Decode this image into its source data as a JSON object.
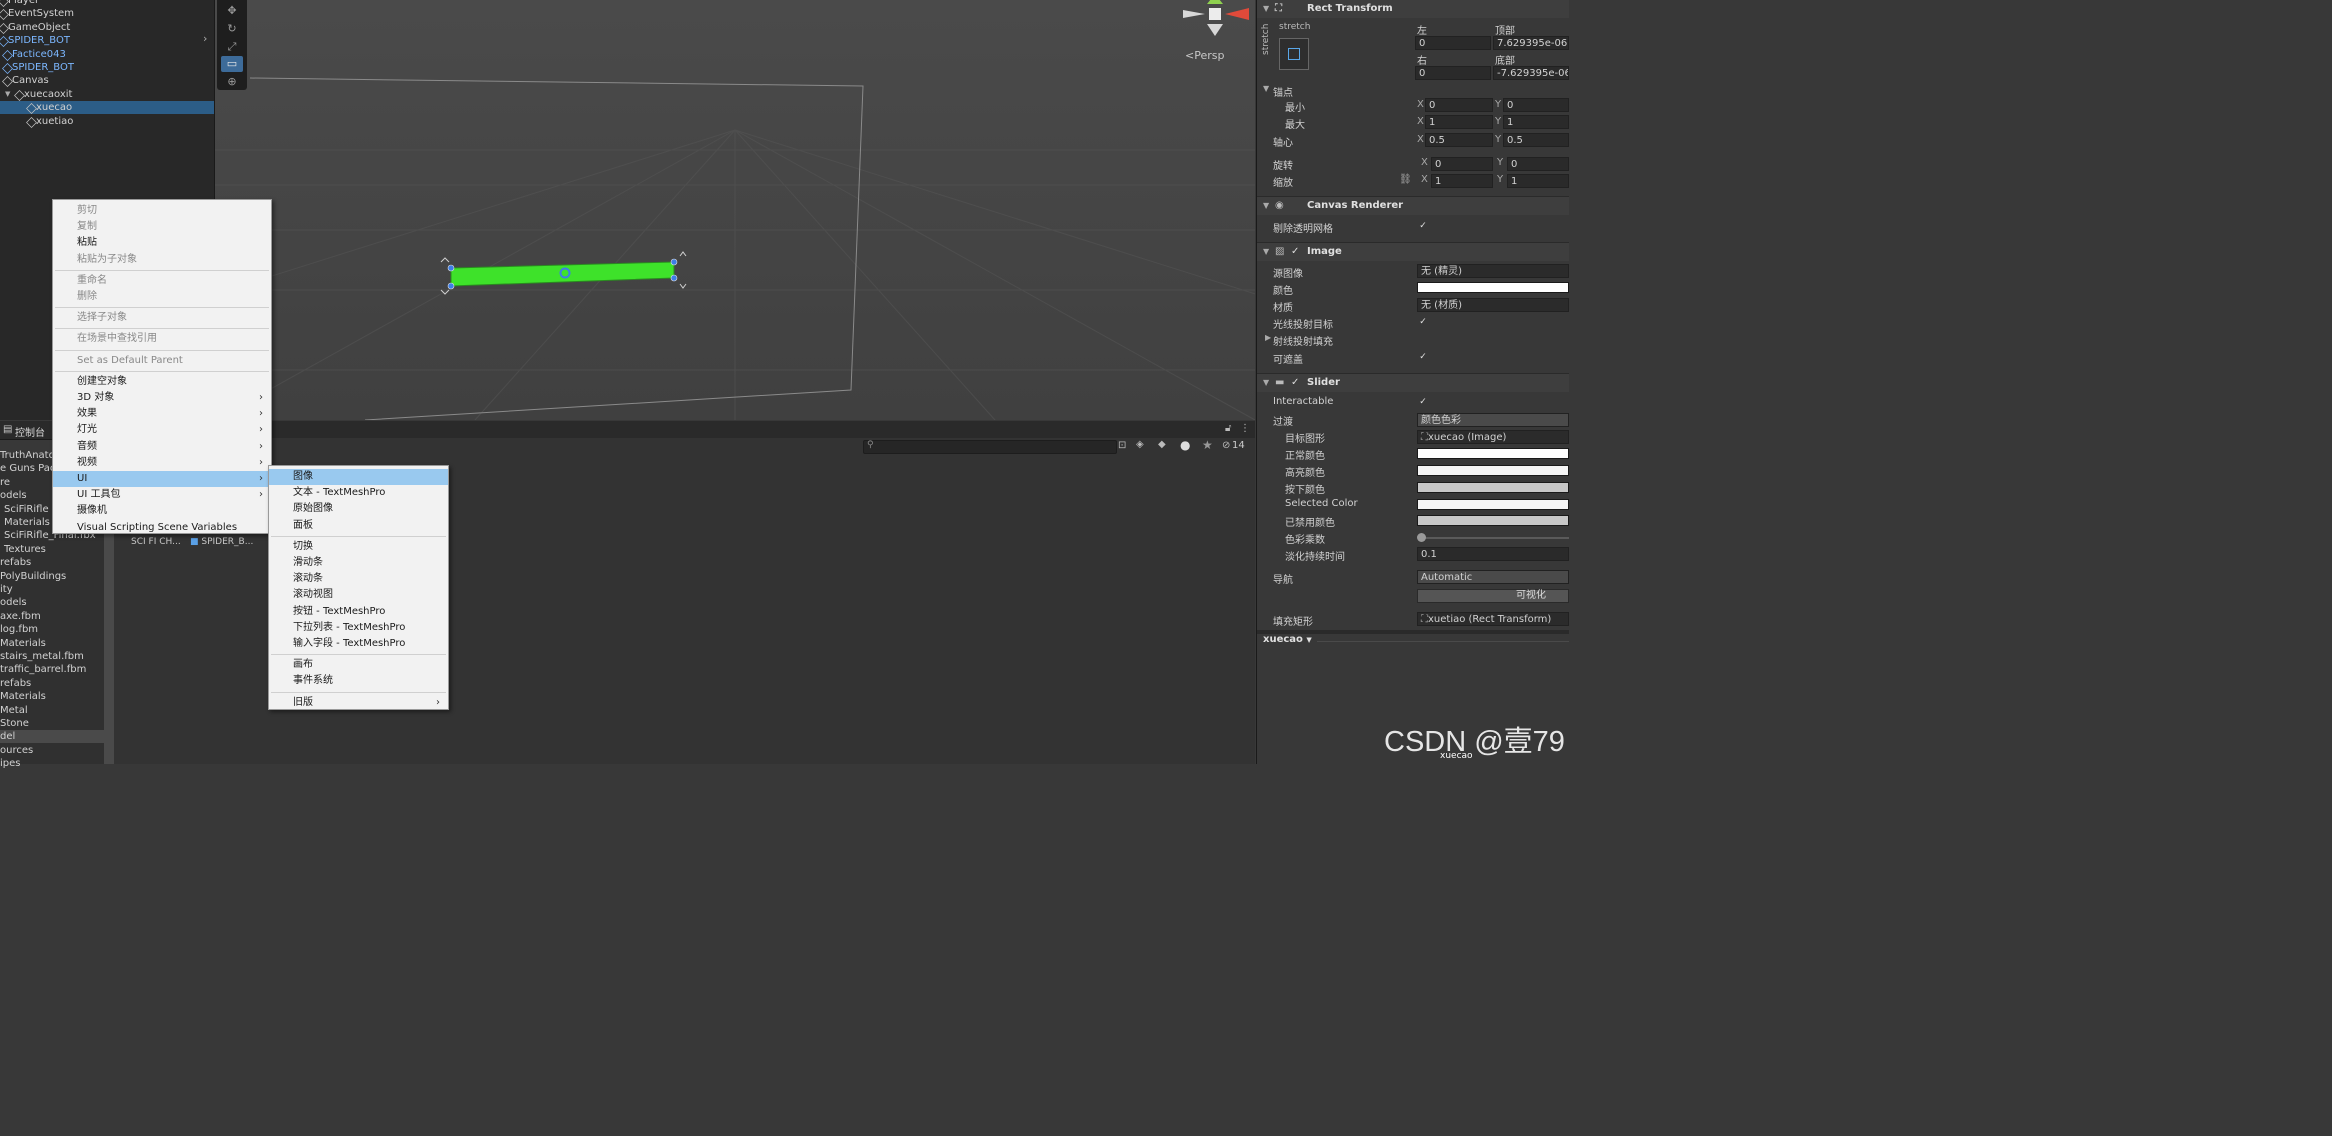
{
  "hierarchy": {
    "items": [
      {
        "label": "Player",
        "indent": 0,
        "style": "normal"
      },
      {
        "label": "EventSystem",
        "indent": 0,
        "style": "normal"
      },
      {
        "label": "GameObject",
        "indent": 0,
        "style": "normal"
      },
      {
        "label": "SPIDER_BOT",
        "indent": 0,
        "style": "blue"
      },
      {
        "label": "Factice043",
        "indent": 1,
        "style": "blue"
      },
      {
        "label": "SPIDER_BOT",
        "indent": 1,
        "style": "blue"
      },
      {
        "label": "Canvas",
        "indent": 1,
        "style": "normal"
      },
      {
        "label": "xuecaoxit",
        "indent": 2,
        "style": "normal"
      },
      {
        "label": "xuecao",
        "indent": 3,
        "style": "selected"
      },
      {
        "label": "xuetiao",
        "indent": 3,
        "style": "normal"
      }
    ]
  },
  "scene": {
    "persp_label": "<Persp"
  },
  "bottom": {
    "tab_label": "控制台",
    "counter": "14",
    "project_items": [
      "TruthAnatom...",
      "e Guns Pack",
      "re",
      "odels",
      "SciFiRifle",
      "Materials",
      "SciFiRifle_Final.fbx",
      "Textures",
      "refabs",
      "PolyBuildings",
      "ity",
      "odels",
      "axe.fbm",
      "log.fbm",
      "Materials",
      "stairs_metal.fbm",
      "traffic_barrel.fbm",
      "refabs",
      "Materials",
      "Metal",
      "Stone",
      "del",
      "ources",
      "ipes"
    ],
    "assets": [
      "SCI FI CH...",
      "SPIDER_B..."
    ]
  },
  "context_menu": {
    "items": [
      {
        "label": "剪切",
        "disabled": true
      },
      {
        "label": "复制",
        "disabled": true
      },
      {
        "label": "粘贴",
        "disabled": false
      },
      {
        "label": "粘贴为子对象",
        "disabled": true
      },
      {
        "sep": true
      },
      {
        "label": "重命名",
        "disabled": true
      },
      {
        "label": "删除",
        "disabled": true
      },
      {
        "sep": true
      },
      {
        "label": "选择子对象",
        "disabled": true
      },
      {
        "sep": true
      },
      {
        "label": "在场景中查找引用",
        "disabled": true
      },
      {
        "sep": true
      },
      {
        "label": "Set as Default Parent",
        "disabled": true
      },
      {
        "sep": true
      },
      {
        "label": "创建空对象",
        "disabled": false
      },
      {
        "label": "3D 对象",
        "disabled": false,
        "sub": true
      },
      {
        "label": "效果",
        "disabled": false,
        "sub": true
      },
      {
        "label": "灯光",
        "disabled": false,
        "sub": true
      },
      {
        "label": "音频",
        "disabled": false,
        "sub": true
      },
      {
        "label": "视频",
        "disabled": false,
        "sub": true
      },
      {
        "label": "UI",
        "disabled": false,
        "sub": true,
        "highlight": true
      },
      {
        "label": "UI 工具包",
        "disabled": false,
        "sub": true
      },
      {
        "label": "摄像机",
        "disabled": false
      },
      {
        "label": "Visual Scripting Scene Variables",
        "disabled": false
      }
    ]
  },
  "ui_submenu": {
    "items": [
      {
        "label": "图像",
        "highlight": true
      },
      {
        "label": "文本 - TextMeshPro"
      },
      {
        "label": "原始图像"
      },
      {
        "label": "面板"
      },
      {
        "sep": true
      },
      {
        "label": "切换"
      },
      {
        "label": "滑动条"
      },
      {
        "label": "滚动条"
      },
      {
        "label": "滚动视图"
      },
      {
        "label": "按钮 - TextMeshPro"
      },
      {
        "label": "下拉列表 - TextMeshPro"
      },
      {
        "label": "输入字段 - TextMeshPro"
      },
      {
        "sep": true
      },
      {
        "label": "画布"
      },
      {
        "label": "事件系统"
      },
      {
        "sep": true
      },
      {
        "label": "旧版",
        "sub": true
      }
    ]
  },
  "inspector": {
    "rect_transform": {
      "title": "Rect Transform",
      "stretch_top": "stretch",
      "stretch_side": "stretch",
      "left_label": "左",
      "left": "0",
      "top_label": "顶部",
      "top": "7.629395e-06",
      "right_label": "右",
      "right": "0",
      "bottom_label": "底部",
      "bottom": "-7.629395e-06",
      "anchors_label": "锚点",
      "min_label": "最小",
      "min_x": "0",
      "min_y": "0",
      "max_label": "最大",
      "max_x": "1",
      "max_y": "1",
      "pivot_label": "轴心",
      "pivot_x": "0.5",
      "pivot_y": "0.5",
      "rotation_label": "旋转",
      "rot_x": "0",
      "rot_y": "0",
      "scale_label": "缩放",
      "scale_x": "1",
      "scale_y": "1"
    },
    "canvas_renderer": {
      "title": "Canvas Renderer",
      "cull_label": "剔除透明网格"
    },
    "image": {
      "title": "Image",
      "source_label": "源图像",
      "source": "无 (精灵)",
      "color_label": "颜色",
      "material_label": "材质",
      "material": "无 (材质)",
      "raycast_label": "光线投射目标",
      "padding_label": "射线投射填充",
      "maskable_label": "可遮盖"
    },
    "slider": {
      "title": "Slider",
      "interactable_label": "Interactable",
      "transition_label": "过渡",
      "transition": "颜色色彩",
      "target_label": "目标图形",
      "target": "xuecao (Image)",
      "normal_label": "正常颜色",
      "highlight_label": "高亮颜色",
      "pressed_label": "按下颜色",
      "selected_label": "Selected Color",
      "disabled_label": "已禁用颜色",
      "multiplier_label": "色彩乘数",
      "fade_label": "淡化持续时间",
      "fade": "0.1",
      "nav_label": "导航",
      "nav": "Automatic",
      "visualize": "可视化",
      "fill_label": "填充矩形",
      "fill": "xuetiao (Rect Transform)"
    },
    "footer_label": "xuecao"
  },
  "watermark": "CSDN @壹79",
  "watermark_sub": "xuecao"
}
